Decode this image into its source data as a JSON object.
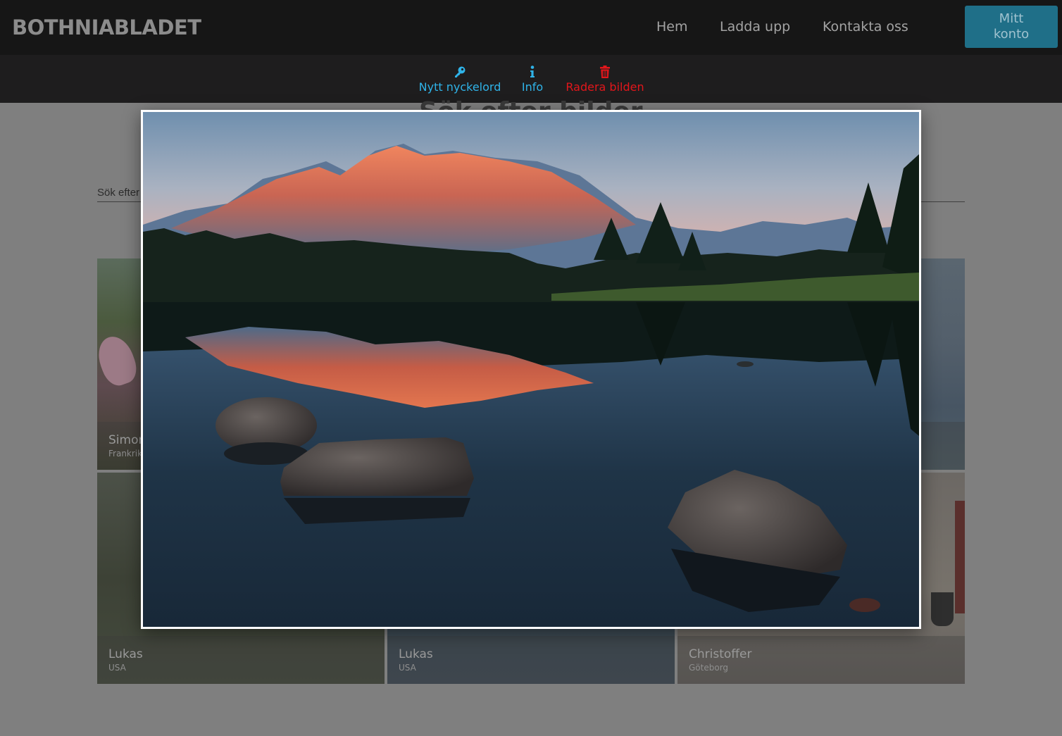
{
  "brand": "BOTHNIABLADET",
  "nav": {
    "home": "Hem",
    "upload": "Ladda upp",
    "contact": "Kontakta oss",
    "account_line1": "Mitt",
    "account_line2": "konto"
  },
  "toolbar": {
    "keyword": "Nytt nyckelord",
    "info": "Info",
    "delete": "Radera bilden",
    "keyword_icon": "key-icon",
    "info_icon": "info-icon",
    "delete_icon": "trash-icon"
  },
  "page": {
    "heading": "Sök efter bilder",
    "search_placeholder": "Sök efter"
  },
  "cards": [
    {
      "name": "Simon",
      "location": "Frankrike"
    },
    {
      "name": "",
      "location": ""
    },
    {
      "name": "",
      "location": ""
    },
    {
      "name": "Lukas",
      "location": "USA"
    },
    {
      "name": "Lukas",
      "location": "USA"
    },
    {
      "name": "Christoffer",
      "location": "Göteborg"
    }
  ],
  "colors": {
    "accent_blue": "#2fb3e8",
    "delete_red": "#e3161b",
    "account_button": "#1f6f88"
  }
}
